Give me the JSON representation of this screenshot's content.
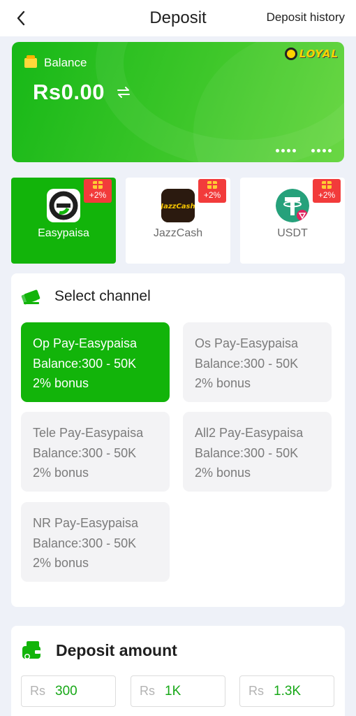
{
  "header": {
    "title": "Deposit",
    "history_link": "Deposit history"
  },
  "balance_card": {
    "label": "Balance",
    "amount": "Rs0.00",
    "brand": "LOYAL"
  },
  "payment_methods": [
    {
      "label": "Easypaisa",
      "bonus": "+2%",
      "selected": true
    },
    {
      "label": "JazzCash",
      "bonus": "+2%",
      "selected": false,
      "logo_text": "JazzCash"
    },
    {
      "label": "USDT",
      "bonus": "+2%",
      "selected": false
    }
  ],
  "channel_section": {
    "title": "Select channel",
    "channels": [
      {
        "name": "Op Pay-Easypaisa",
        "range": "Balance:300 - 50K",
        "bonus": "2% bonus",
        "selected": true
      },
      {
        "name": "Os Pay-Easypaisa",
        "range": "Balance:300 - 50K",
        "bonus": "2% bonus",
        "selected": false
      },
      {
        "name": "Tele Pay-Easypaisa",
        "range": "Balance:300 - 50K",
        "bonus": "2% bonus",
        "selected": false
      },
      {
        "name": "All2 Pay-Easypaisa",
        "range": "Balance:300 - 50K",
        "bonus": "2% bonus",
        "selected": false
      },
      {
        "name": "NR Pay-Easypaisa",
        "range": "Balance:300 - 50K",
        "bonus": "2% bonus",
        "selected": false
      }
    ]
  },
  "amount_section": {
    "title": "Deposit amount",
    "currency": "Rs",
    "options": [
      "300",
      "1K",
      "1.3K"
    ]
  },
  "colors": {
    "accent_green": "#12b40a",
    "bonus_red": "#f23b3b",
    "page_bg": "#eef1f8"
  },
  "icons": [
    "back-arrow-icon",
    "wallet-icon",
    "refresh-icon",
    "gift-icon",
    "card-edit-icon",
    "money-wallet-icon"
  ]
}
